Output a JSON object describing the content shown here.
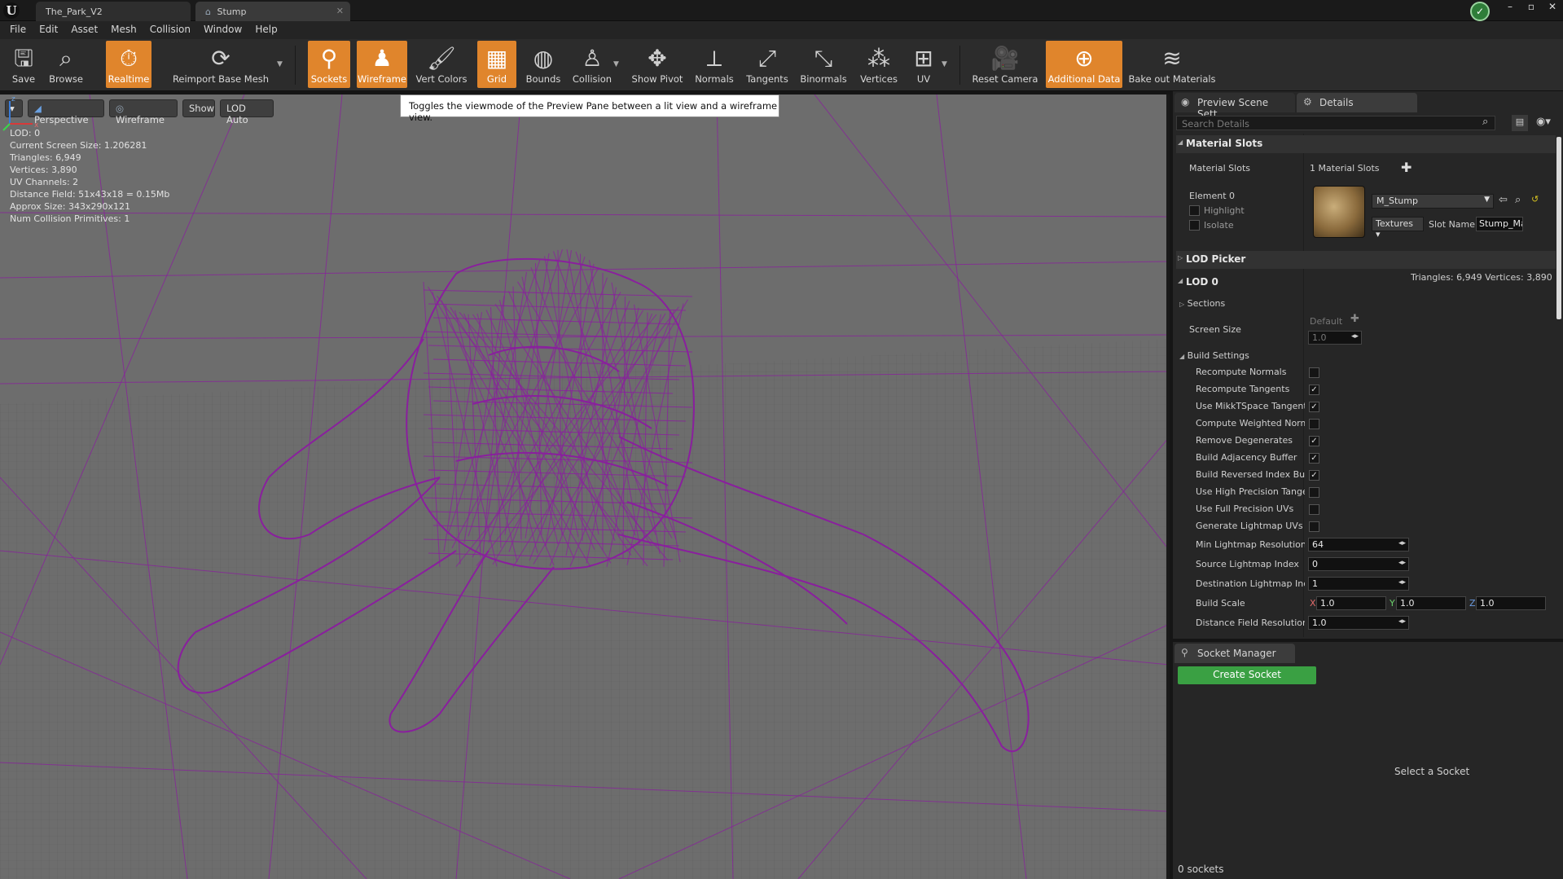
{
  "window": {
    "tabs": [
      "The_Park_V2",
      "Stump"
    ],
    "controls": [
      "–",
      "▫",
      "✕"
    ]
  },
  "menubar": [
    "File",
    "Edit",
    "Asset",
    "Mesh",
    "Collision",
    "Window",
    "Help"
  ],
  "toolbar": {
    "save": "Save",
    "browse": "Browse",
    "realtime": "Realtime",
    "reimport": "Reimport Base Mesh",
    "sockets": "Sockets",
    "wireframe": "Wireframe",
    "vert_colors": "Vert Colors",
    "grid": "Grid",
    "bounds": "Bounds",
    "collision": "Collision",
    "show_pivot": "Show Pivot",
    "normals": "Normals",
    "tangents": "Tangents",
    "binormals": "Binormals",
    "vertices": "Vertices",
    "uv": "UV",
    "reset_camera": "Reset Camera",
    "additional_data": "Additional Data",
    "bake_out": "Bake out Materials"
  },
  "tooltip": "Toggles the viewmode of the Preview Pane between a lit view and a wireframe view.",
  "viewport": {
    "perspective": "Perspective",
    "wireframe": "Wireframe",
    "show": "Show",
    "lod_auto": "LOD Auto",
    "stats": [
      "LOD:  0",
      "Current Screen Size:  1.206281",
      "Triangles:  6,949",
      "Vertices:  3,890",
      "UV Channels:  2",
      "Distance Field:  51x43x18 = 0.15Mb",
      "Approx Size: 343x290x121",
      "Num Collision Primitives:  1"
    ],
    "accent_color": "#8a1f9e"
  },
  "details": {
    "tab_preview": "Preview Scene Sett",
    "tab_details": "Details",
    "search_placeholder": "Search Details",
    "material_slots_header": "Material Slots",
    "material_slots_label": "Material Slots",
    "material_slots_count": "1 Material Slots",
    "element": "Element 0",
    "highlight": "Highlight",
    "isolate": "Isolate",
    "material_name": "M_Stump",
    "textures": "Textures",
    "slot_name_label": "Slot Name",
    "slot_name_value": "Stump_Ma",
    "lod_picker": "LOD Picker",
    "lod0": "LOD 0",
    "lod_stats": "Triangles: 6,949    Vertices: 3,890",
    "sections": "Sections",
    "screen_size": "Screen Size",
    "screen_default": "Default",
    "screen_value": "1.0",
    "build_settings": "Build Settings",
    "settings": [
      {
        "label": "Recompute Normals",
        "checked": false
      },
      {
        "label": "Recompute Tangents",
        "checked": true
      },
      {
        "label": "Use MikkTSpace Tangent",
        "checked": true
      },
      {
        "label": "Compute Weighted Norma",
        "checked": false
      },
      {
        "label": "Remove Degenerates",
        "checked": true
      },
      {
        "label": "Build Adjacency Buffer",
        "checked": true
      },
      {
        "label": "Build Reversed Index Buffe",
        "checked": true
      },
      {
        "label": "Use High Precision Tanger",
        "checked": false
      },
      {
        "label": "Use Full Precision UVs",
        "checked": false
      },
      {
        "label": "Generate Lightmap UVs",
        "checked": false
      }
    ],
    "min_lightmap_label": "Min Lightmap Resolution",
    "min_lightmap_value": "64",
    "source_lightmap_label": "Source Lightmap Index",
    "source_lightmap_value": "0",
    "dest_lightmap_label": "Destination Lightmap Inde",
    "dest_lightmap_value": "1",
    "build_scale_label": "Build Scale",
    "build_scale": {
      "x": "1.0",
      "y": "1.0",
      "z": "1.0"
    },
    "distance_field_label": "Distance Field Resolution S",
    "distance_field_value": "1.0"
  },
  "socket_manager": {
    "tab": "Socket Manager",
    "create": "Create Socket",
    "select": "Select a Socket",
    "count": "0 sockets"
  }
}
